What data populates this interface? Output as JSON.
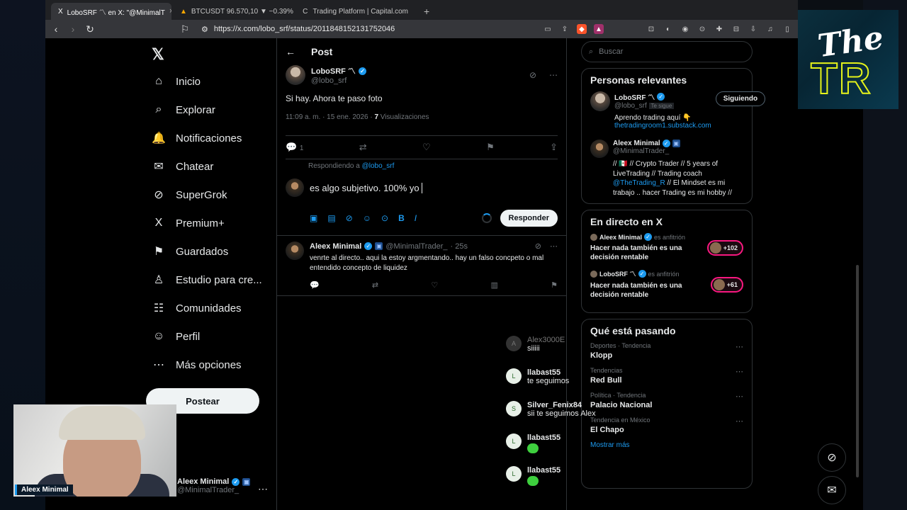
{
  "browser": {
    "tabs": [
      {
        "label": "LoboSRF 〽 en X: \"@MinimalT",
        "active": true
      },
      {
        "label": "BTCUSDT 96.570,10 ▼ −0.39% ES",
        "active": false
      },
      {
        "label": "Trading Platform | Capital.com",
        "active": false
      }
    ],
    "new_tab": "+",
    "tab_close": "×",
    "url": "https://x.com/lobo_srf/status/2011848152131752046"
  },
  "overlay": {
    "brand_top": "The",
    "brand_bottom": "TR"
  },
  "nav": {
    "items": [
      {
        "label": "Inicio",
        "icon": "home-icon",
        "glyph": "⌂"
      },
      {
        "label": "Explorar",
        "icon": "search-icon",
        "glyph": "⌕"
      },
      {
        "label": "Notificaciones",
        "icon": "bell-icon",
        "glyph": "🔔"
      },
      {
        "label": "Chatear",
        "icon": "mail-icon",
        "glyph": "✉"
      },
      {
        "label": "SuperGrok",
        "icon": "grok-icon",
        "glyph": "⊘"
      },
      {
        "label": "Premium+",
        "icon": "x-icon",
        "glyph": "X"
      },
      {
        "label": "Guardados",
        "icon": "bookmark-icon",
        "glyph": "⚑"
      },
      {
        "label": "Estudio para cre...",
        "icon": "studio-icon",
        "glyph": "♙"
      },
      {
        "label": "Comunidades",
        "icon": "people-icon",
        "glyph": "☷"
      },
      {
        "label": "Perfil",
        "icon": "person-icon",
        "glyph": "☺"
      },
      {
        "label": "Más opciones",
        "icon": "more-circle-icon",
        "glyph": "⋯"
      }
    ],
    "post_button": "Postear",
    "account_name": "Aleex Minimal",
    "account_handle": "@MinimalTrader_"
  },
  "post": {
    "header_title": "Post",
    "author_name": "LoboSRF 〽",
    "author_handle": "@lobo_srf",
    "text": "Si hay. Ahora te paso foto",
    "meta_time": "11:09 a. m. · 15 ene. 2026 ·",
    "views_count": "7",
    "views_label": "Visualizaciones",
    "replies_count": "1"
  },
  "composer": {
    "replying_to_label": "Respondiendo a",
    "replying_to_handle": "@lobo_srf",
    "draft": "es algo subjetivo. 100% yo",
    "reply_button": "Responder"
  },
  "reply": {
    "author_name": "Aleex Minimal",
    "author_handle": "@MinimalTrader_",
    "time": "· 25s",
    "text": "venrte al directo.. aqui la estoy argmentando..   hay un falso concpeto o mal entendido concepto de liquidez"
  },
  "right": {
    "search_placeholder": "Buscar",
    "relevant_title": "Personas relevantes",
    "people": [
      {
        "name": "LoboSRF 〽",
        "handle": "@lobo_srf",
        "follows_you": "Te sigue",
        "button": "Siguiendo",
        "bio": "Aprendo trading aquí 👇",
        "link": "thetradingroom1.substack.com"
      },
      {
        "name": "Aleex Minimal",
        "handle": "@MinimalTrader_",
        "bio_pre": "// 🇲🇽 // Crypto Trader // 5 years of LiveTrading // Trading coach",
        "bio_link": "@TheTrading_R",
        "bio_post": " // El Mindset es mi trabajo .. hacer Trading es mi hobby //"
      }
    ],
    "live_title": "En directo en X",
    "lives": [
      {
        "host": "Aleex Minimal",
        "host_label": "es anfitrión",
        "title": "Hacer nada también es una decisión rentable",
        "count": "+102"
      },
      {
        "host": "LoboSRF 〽",
        "host_label": "es anfitrión",
        "title": "Hacer nada también es una decisión rentable",
        "count": "+61"
      }
    ],
    "trending_title": "Qué está pasando",
    "trends": [
      {
        "context": "Deportes · Tendencia",
        "name": "Klopp"
      },
      {
        "context": "Tendencias",
        "name": "Red Bull"
      },
      {
        "context": "Política · Tendencia",
        "name": "Palacio Nacional"
      },
      {
        "context": "Tendencia en México",
        "name": "El Chapo"
      }
    ],
    "show_more": "Mostrar más"
  },
  "chat": [
    {
      "initial": "A",
      "name": "Alex3000E",
      "text": "siiiii",
      "dim": true
    },
    {
      "initial": "L",
      "name": "llabast55",
      "text": "te seguimos"
    },
    {
      "initial": "S",
      "name": "Silver_Fenix84",
      "text": "sii te seguimos Alex"
    },
    {
      "initial": "L",
      "name": "llabast55",
      "text": ""
    },
    {
      "initial": "L",
      "name": "llabast55",
      "text": ""
    }
  ],
  "webcam": {
    "label": "Aleex Minimal"
  },
  "colors": {
    "accent": "#1d9bf0",
    "live_ring": "#f91880",
    "background": "#000000"
  }
}
